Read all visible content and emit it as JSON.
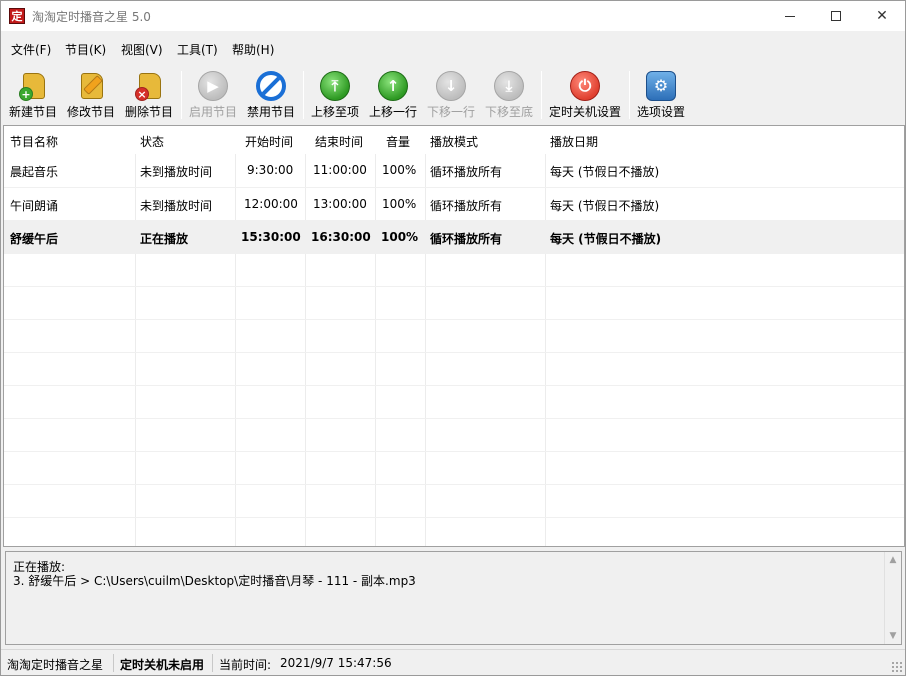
{
  "window": {
    "title": "淘淘定时播音之星 5.0",
    "app_icon_char": "定"
  },
  "menu": {
    "items": [
      "文件(F)",
      "节目(K)",
      "视图(V)",
      "工具(T)",
      "帮助(H)"
    ]
  },
  "toolbar": {
    "new": "新建节目",
    "edit": "修改节目",
    "delete": "删除节目",
    "enable": "启用节目",
    "disable": "禁用节目",
    "move_top": "上移至项",
    "move_up": "上移一行",
    "move_down": "下移一行",
    "move_bottom": "下移至底",
    "shutdown": "定时关机设置",
    "options": "选项设置"
  },
  "table": {
    "headers": [
      "节目名称",
      "状态",
      "开始时间",
      "结束时间",
      "音量",
      "播放模式",
      "播放日期"
    ],
    "rows": [
      [
        "晨起音乐",
        "未到播放时间",
        "9:30:00",
        "11:00:00",
        "100%",
        "循环播放所有",
        "每天 (节假日不播放)"
      ],
      [
        "午间朗诵",
        "未到播放时间",
        "12:00:00",
        "13:00:00",
        "100%",
        "循环播放所有",
        "每天 (节假日不播放)"
      ],
      [
        "舒缓午后",
        "正在播放",
        "15:30:00",
        "16:30:00",
        "100%",
        "循环播放所有",
        "每天 (节假日不播放)"
      ]
    ],
    "selected_row": 2
  },
  "now_playing": {
    "label": "正在播放:",
    "track": "3. 舒缓午后 > C:\\Users\\cuilm\\Desktop\\定时播音\\月琴 - 111 - 副本.mp3"
  },
  "status": {
    "app_name": "淘淘定时播音之星",
    "shutdown_state": "定时关机未启用",
    "current_time_label": "当前时间:",
    "current_time": "2021/9/7 15:47:56"
  },
  "colors": {
    "accent_green": "#2e9a23",
    "disabled_gray": "#bdbdbd",
    "stop_blue": "#1a6fd6",
    "power_red": "#e04030"
  }
}
